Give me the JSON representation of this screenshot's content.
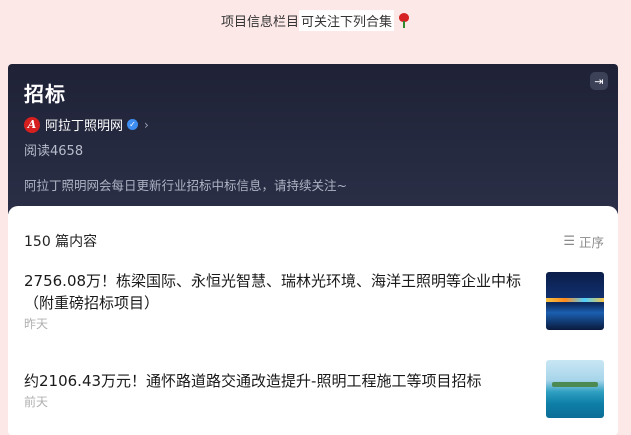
{
  "top_note": {
    "prefix": "项目信息栏目",
    "highlight": "可关注下列合集",
    "emoji_icon": "rose-icon"
  },
  "header": {
    "title": "招标",
    "exit_icon": "exit-icon",
    "account_name": "阿拉丁照明网",
    "logo_letter": "A",
    "verified_icon": "verified-badge-icon",
    "chevron": "›",
    "reads": "阅读4658",
    "description": "阿拉丁照明网会每日更新行业招标中标信息，请持续关注~"
  },
  "list": {
    "count": "150 篇内容",
    "sort_label": "正序",
    "sort_icon": "sort-icon",
    "articles": [
      {
        "title": "2756.08万！栋梁国际、永恒光智慧、瑞林光环境、海洋王照明等企业中标（附重磅招标项目）",
        "time": "昨天"
      },
      {
        "title": "约2106.43万元！通怀路道路交通改造提升-照明工程施工等项目招标",
        "time": "前天"
      }
    ]
  },
  "colors": {
    "page_bg": "#fde8e8",
    "header_bg": "#1f2236",
    "logo_red": "#d61f1f",
    "verified_blue": "#3d8ef0"
  }
}
